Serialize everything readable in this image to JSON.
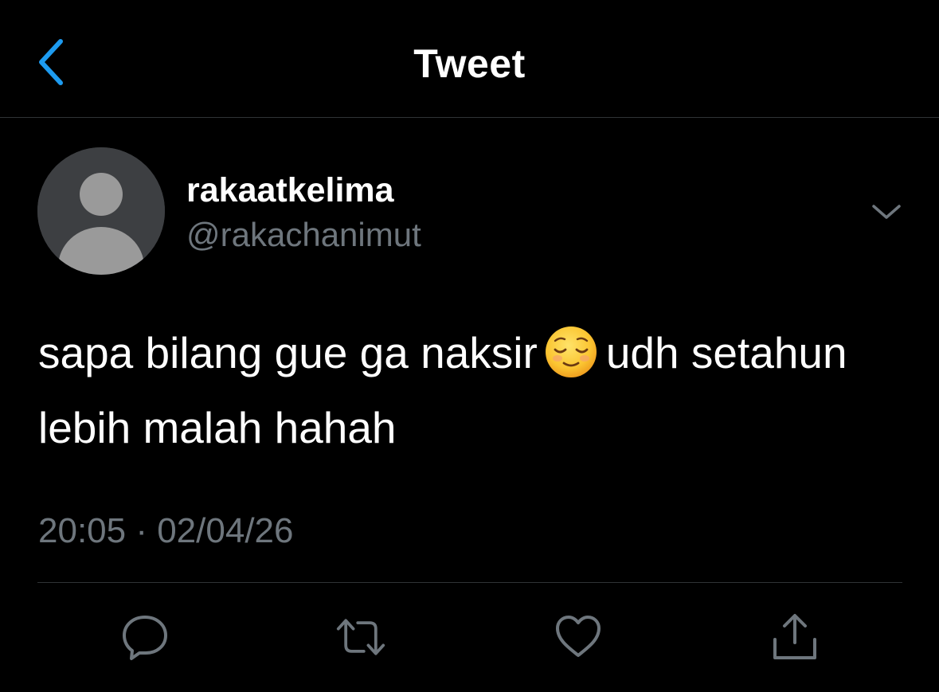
{
  "header": {
    "title": "Tweet",
    "back_icon": "chevron-left-icon"
  },
  "colors": {
    "background": "#000000",
    "accent": "#1d9bf0",
    "secondary_text": "#6e767d",
    "divider": "#2f3336",
    "avatar_bg": "#3d3f42",
    "avatar_fg": "#9a9a9a"
  },
  "author": {
    "display_name": "rakaatkelima",
    "handle": "@rakachanimut",
    "avatar_icon": "default-avatar-icon",
    "more_icon": "chevron-down-icon"
  },
  "tweet": {
    "text_part1": "sapa bilang gue ga naksir",
    "emoji_icon": "relieved-face-emoji",
    "text_part2": "udh setahun lebih malah hahah",
    "timestamp": "20:05 · 02/04/26"
  },
  "actions": [
    {
      "name": "reply",
      "icon": "reply-icon"
    },
    {
      "name": "retweet",
      "icon": "retweet-icon"
    },
    {
      "name": "like",
      "icon": "heart-icon"
    },
    {
      "name": "share",
      "icon": "share-icon"
    }
  ]
}
